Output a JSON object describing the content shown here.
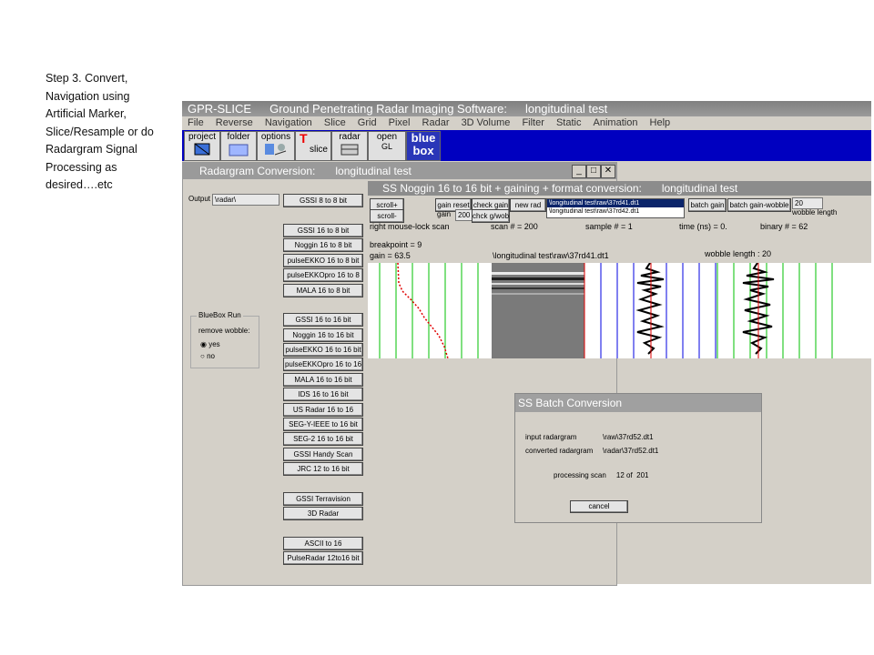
{
  "step_text": "Step 3.  Convert,\nNavigation using\nArtificial Marker,\nSlice/Resample or do\nRadargram Signal\nProcessing as\ndesired….etc",
  "app": {
    "title_app": "GPR-SLICE",
    "title_desc": "Ground Penetrating Radar Imaging Software:",
    "title_project": "longitudinal test",
    "menu": [
      "File",
      "Reverse",
      "Navigation",
      "Slice",
      "Grid",
      "Pixel",
      "Radar",
      "3D Volume",
      "Filter",
      "Static",
      "Animation",
      "Help"
    ],
    "toolbar": {
      "project": "project",
      "folder": "folder",
      "options": "options",
      "slice_t": "T",
      "slice": "slice",
      "radar": "radar",
      "open": "open",
      "gl": "GL",
      "blue": "blue",
      "box": "box"
    }
  },
  "conv": {
    "title": "Radargram Conversion:",
    "project": "longitudinal test",
    "minimize": "_",
    "maximize": "□",
    "close": "✕",
    "output_label": "Output",
    "output_value": "\\radar\\",
    "bluebox": {
      "title": "BlueBox Run",
      "remove_wobble": "remove wobble:",
      "yes": "yes",
      "no": "no"
    },
    "buttons": [
      "GSSI 8 to 8 bit",
      "GSSI 16 to 8 bit",
      "Noggin 16 to 8 bit",
      "pulseEKKO 16 to 8 bit",
      "pulseEKKOpro 16 to 8",
      "MALA 16 to 8 bit",
      "GSSI 16 to 16 bit",
      "Noggin 16 to 16 bit",
      "pulseEKKO 16 to 16 bit",
      "pulseEKKOpro 16 to 16",
      "MALA 16 to 16 bit",
      "IDS 16 to 16 bit",
      "US Radar 16 to 16",
      "SEG-Y-IEEE to 16 bit",
      "SEG-2 16 to 16 bit",
      "GSSI Handy Scan",
      "JRC 12 to 16 bit",
      "GSSI Terravision",
      "3D Radar",
      "ASCII to 16",
      "PulseRadar 12to16 bit"
    ]
  },
  "noggin": {
    "title": "SS Noggin 16 to 16 bit + gaining + format conversion:",
    "project": "longitudinal test",
    "btn": {
      "scroll_plus": "scroll+",
      "scroll_minus": "scroll-",
      "gain_reset": "gain reset",
      "gain": "gain",
      "gain_value": "200",
      "check_gain": "check gain",
      "chck_gwob": "chck g/wob",
      "new_rad": "new rad",
      "batch_gain": "batch gain",
      "batch_gain_wobble": "batch gain-wobble"
    },
    "files": [
      "\\longitudinal test\\raw\\37rd41.dt1",
      "\\longitudinal test\\raw\\37rd42.dt1"
    ],
    "wobble_value": "20",
    "wobble_length_label": "wobble length",
    "right_mouse": "right mouse-lock scan",
    "scan": "scan # =      200",
    "sample": "sample # =  1",
    "time": "time (ns) = 0.",
    "binary": "binary # = 62",
    "breakpoint": "breakpoint =    9",
    "gain_line": "gain =          63.5",
    "filename": "\\longitudinal test\\raw\\37rd41.dt1",
    "wobble_len": "wobble length :   20"
  },
  "batch": {
    "title": "SS Batch Conversion",
    "input_label": "input radargram",
    "input_value": "\\raw\\37rd52.dt1",
    "converted_label": "converted radargram",
    "converted_value": "\\radar\\37rd52.dt1",
    "processing": "processing scan     12 of  201",
    "cancel": "cancel"
  },
  "colors": {
    "toolbar_blue": "#0000c0",
    "green": "#00c000",
    "red": "#e00000",
    "blue": "#0000e0"
  }
}
